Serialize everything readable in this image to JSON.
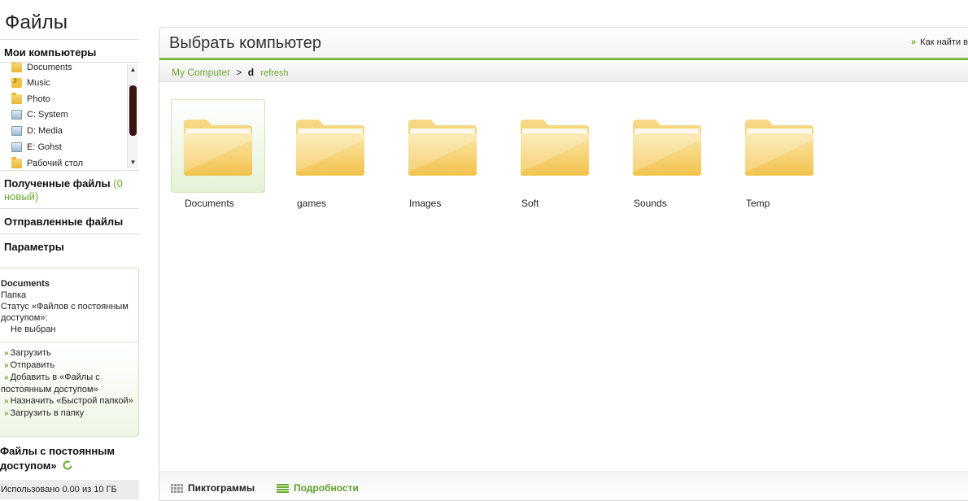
{
  "page_title": "Файлы",
  "sidebar": {
    "my_computers": "Мои компьютеры",
    "tree": [
      {
        "label": "Documents",
        "icon": "folder-icon"
      },
      {
        "label": "Music",
        "icon": "music-folder-icon"
      },
      {
        "label": "Photo",
        "icon": "folder-icon"
      },
      {
        "label": "C: System",
        "icon": "drive-icon"
      },
      {
        "label": "D: Media",
        "icon": "drive-icon"
      },
      {
        "label": "E: Gohst",
        "icon": "drive-icon"
      },
      {
        "label": "Рабочий стол",
        "icon": "folder-icon"
      }
    ],
    "received_files": "Полученные файлы",
    "received_new": "(0 новый)",
    "sent_files": "Отправленные файлы",
    "settings": "Параметры"
  },
  "info": {
    "name": "Documents",
    "type": "Папка",
    "status_label": "Статус «Файлов с постоянным доступом»:",
    "status_value": "Не выбран",
    "actions": [
      "Загрузить",
      "Отправить",
      "Добавить в «Файлы с постоянным доступом»",
      "Назначить «Быстрой папкой»",
      "Загрузить в папку"
    ]
  },
  "pinned": {
    "title": "Файлы с постоянным доступом»"
  },
  "usage": "Использовано 0.00 из 10 ГБ",
  "main": {
    "title": "Выбрать компьютер",
    "help_link": "Как найти в",
    "breadcrumb": {
      "root": "My Computer",
      "separator": ">",
      "current": "d",
      "refresh": "refresh"
    },
    "folders": [
      {
        "label": "Documents",
        "selected": true
      },
      {
        "label": "games",
        "selected": false
      },
      {
        "label": "Images",
        "selected": false
      },
      {
        "label": "Soft",
        "selected": false
      },
      {
        "label": "Sounds",
        "selected": false
      },
      {
        "label": "Temp",
        "selected": false
      }
    ],
    "views": {
      "icons": "Пиктограммы",
      "details": "Подробности"
    }
  },
  "colors": {
    "accent_green": "#6aab2e",
    "header_rule": "#7cba40",
    "folder_yellow": "#f2c24c"
  }
}
